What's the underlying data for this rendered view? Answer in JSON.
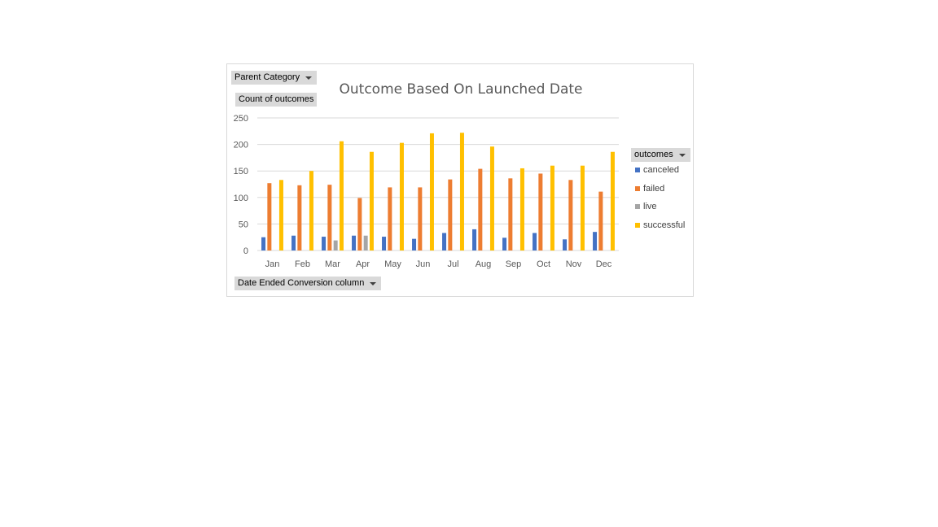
{
  "pivot": {
    "filter_button": "Parent Category",
    "values_label": "Count of outcomes",
    "axis_button": "Date Ended Conversion column",
    "legend_button": "outcomes"
  },
  "chart_data": {
    "type": "bar",
    "title": "Outcome Based On Launched Date",
    "xlabel": "",
    "ylabel": "",
    "categories": [
      "Jan",
      "Feb",
      "Mar",
      "Apr",
      "May",
      "Jun",
      "Jul",
      "Aug",
      "Sep",
      "Oct",
      "Nov",
      "Dec"
    ],
    "series": [
      {
        "name": "canceled",
        "color": "#4472c4",
        "values": [
          25,
          28,
          26,
          28,
          26,
          22,
          33,
          40,
          24,
          33,
          21,
          35
        ]
      },
      {
        "name": "failed",
        "color": "#ed7d31",
        "values": [
          127,
          123,
          124,
          99,
          119,
          119,
          134,
          154,
          136,
          145,
          133,
          111
        ]
      },
      {
        "name": "live",
        "color": "#a5a5a5",
        "values": [
          0,
          0,
          19,
          28,
          0,
          0,
          0,
          0,
          0,
          0,
          0,
          0
        ]
      },
      {
        "name": "successful",
        "color": "#ffc000",
        "values": [
          133,
          150,
          206,
          186,
          203,
          221,
          222,
          196,
          155,
          160,
          160,
          186
        ]
      }
    ],
    "ylim": [
      0,
      250
    ],
    "yticks": [
      0,
      50,
      100,
      150,
      200,
      250
    ],
    "grid": true,
    "legend_position": "right"
  }
}
